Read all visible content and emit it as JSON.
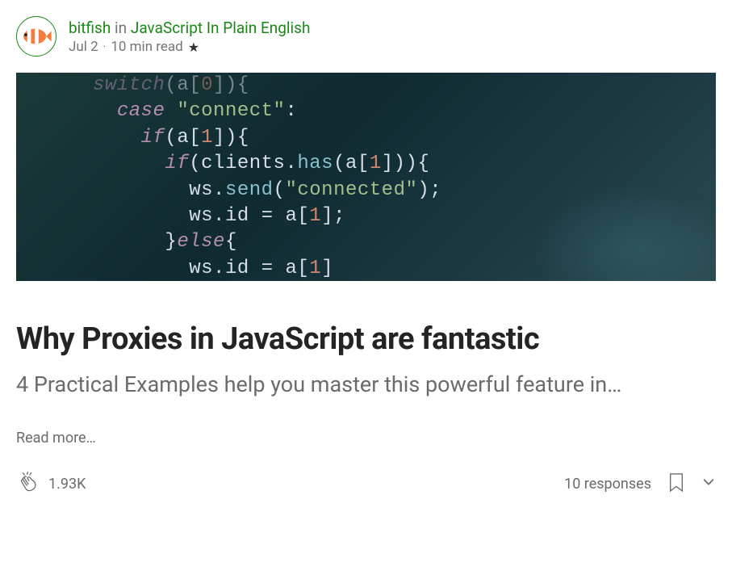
{
  "header": {
    "author": "bitfish",
    "in_word": "in",
    "publication": "JavaScript In Plain English",
    "date": "Jul 2",
    "read_time": "10 min read",
    "has_star": true
  },
  "hero_code": {
    "lines": [
      {
        "indent": 0,
        "tokens": [
          [
            "kw",
            "switch"
          ],
          [
            "punc",
            "("
          ],
          [
            "var",
            "a"
          ],
          [
            "punc",
            "["
          ],
          [
            "num",
            "0"
          ],
          [
            "punc",
            "]"
          ],
          [
            "punc",
            ")"
          ],
          [
            "punc",
            "{"
          ]
        ]
      },
      {
        "indent": 1,
        "tokens": [
          [
            "kw",
            "case"
          ],
          [
            "var",
            " "
          ],
          [
            "str",
            "\"connect\""
          ],
          [
            "punc",
            ":"
          ]
        ]
      },
      {
        "indent": 2,
        "tokens": [
          [
            "kw",
            "if"
          ],
          [
            "punc",
            "("
          ],
          [
            "var",
            "a"
          ],
          [
            "punc",
            "["
          ],
          [
            "num",
            "1"
          ],
          [
            "punc",
            "]"
          ],
          [
            "punc",
            ")"
          ],
          [
            "punc",
            "{"
          ]
        ]
      },
      {
        "indent": 3,
        "tokens": [
          [
            "kw",
            "if"
          ],
          [
            "punc",
            "("
          ],
          [
            "var",
            "clients"
          ],
          [
            "punc",
            "."
          ],
          [
            "call",
            "has"
          ],
          [
            "punc",
            "("
          ],
          [
            "var",
            "a"
          ],
          [
            "punc",
            "["
          ],
          [
            "num",
            "1"
          ],
          [
            "punc",
            "]"
          ],
          [
            "punc",
            ")"
          ],
          [
            "punc",
            ")"
          ],
          [
            "punc",
            "{"
          ]
        ]
      },
      {
        "indent": 4,
        "tokens": [
          [
            "var",
            "ws"
          ],
          [
            "punc",
            "."
          ],
          [
            "call",
            "send"
          ],
          [
            "punc",
            "("
          ],
          [
            "str",
            "\"connected\""
          ],
          [
            "punc",
            ")"
          ],
          [
            "punc",
            ";"
          ]
        ]
      },
      {
        "indent": 4,
        "tokens": [
          [
            "var",
            "ws"
          ],
          [
            "punc",
            "."
          ],
          [
            "var",
            "id"
          ],
          [
            "var",
            " = "
          ],
          [
            "var",
            "a"
          ],
          [
            "punc",
            "["
          ],
          [
            "num",
            "1"
          ],
          [
            "punc",
            "]"
          ],
          [
            "punc",
            ";"
          ]
        ]
      },
      {
        "indent": 3,
        "tokens": [
          [
            "punc",
            "}"
          ],
          [
            "kw",
            "else"
          ],
          [
            "punc",
            "{"
          ]
        ]
      },
      {
        "indent": 4,
        "tokens": [
          [
            "var",
            "ws"
          ],
          [
            "punc",
            "."
          ],
          [
            "var",
            "id"
          ],
          [
            "var",
            " = "
          ],
          [
            "var",
            "a"
          ],
          [
            "punc",
            "["
          ],
          [
            "num",
            "1"
          ],
          [
            "punc",
            "]"
          ]
        ]
      }
    ]
  },
  "article": {
    "title": "Why Proxies in JavaScript are fantastic",
    "subtitle": "4 Practical Examples help you master this powerful feature in…",
    "read_more": "Read more…"
  },
  "footer": {
    "claps": "1.93K",
    "responses": "10 responses"
  }
}
